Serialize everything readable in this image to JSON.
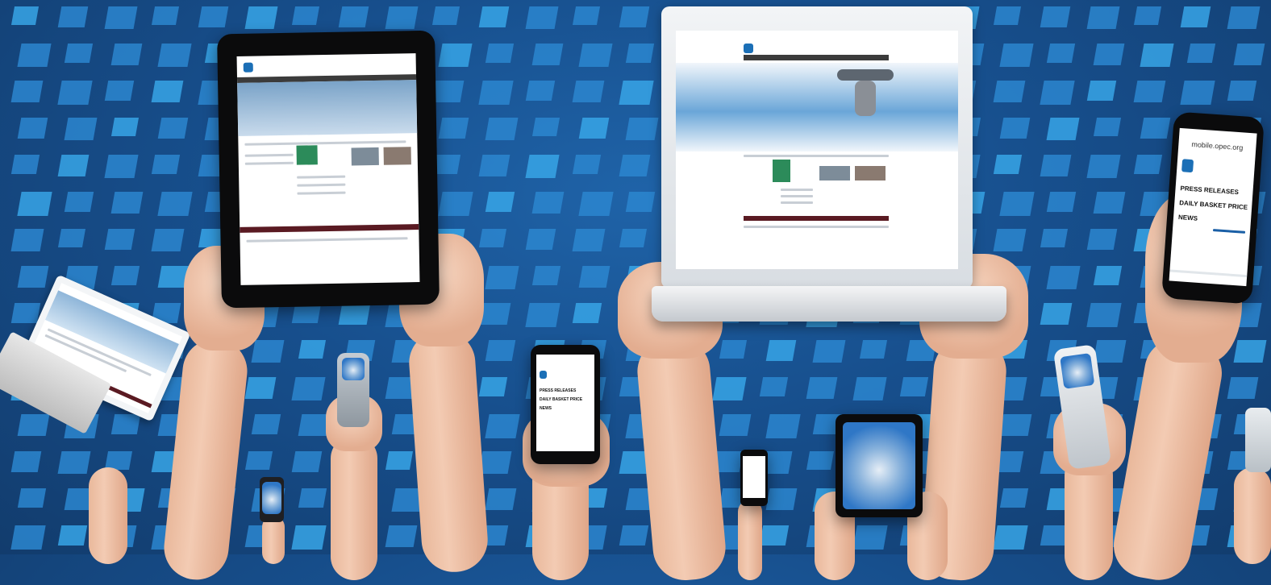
{
  "phone_large": {
    "url": "mobile.opec.org",
    "menu": [
      "PRESS RELEASES",
      "DAILY BASKET PRICE",
      "NEWS"
    ]
  },
  "phone_small": {
    "menu": [
      "PRESS RELEASES",
      "DAILY BASKET PRICE",
      "NEWS"
    ]
  },
  "colors": {
    "background": "#174f8d",
    "tile": "#2c86cf",
    "site_footer": "#5a1a22",
    "logo": "#1b6fb6"
  }
}
